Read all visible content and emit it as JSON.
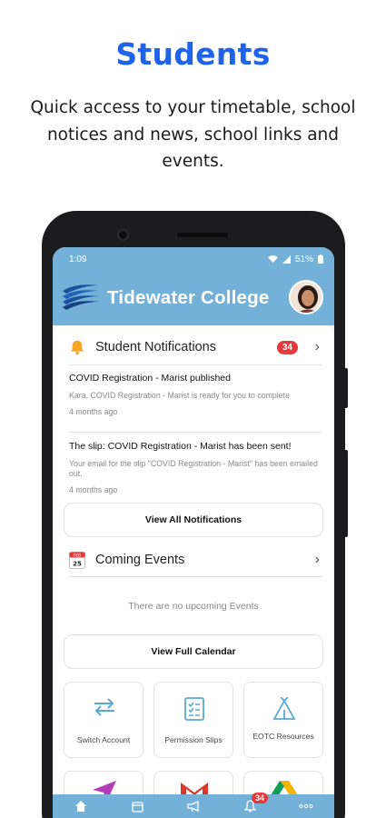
{
  "promo": {
    "title": "Students",
    "subtitle": "Quick access to your timetable, school notices and news, school links and events."
  },
  "status_bar": {
    "time": "1:09",
    "battery": "51%"
  },
  "app": {
    "title": "Tidewater College"
  },
  "notifications": {
    "title": "Student Notifications",
    "badge": "34",
    "items": [
      {
        "title": "COVID Registration - Marist published",
        "body": "Kara, COVID Registration - Marist is ready for you to complete",
        "time": "4 months ago"
      },
      {
        "title": "The slip: COVID Registration - Marist has been sent!",
        "body": "Your email for the slip \"COVID Registration - Marist\" has been emailed out.",
        "time": "4 months ago"
      }
    ],
    "view_all_label": "View All Notifications"
  },
  "events": {
    "title": "Coming Events",
    "calendar_month": "FEB",
    "calendar_day": "25",
    "empty_text": "There are no upcoming Events",
    "view_calendar_label": "View Full Calendar"
  },
  "tiles": [
    {
      "label": "Switch Account",
      "icon": "swap-arrows-icon"
    },
    {
      "label": "Permission Slips",
      "icon": "checklist-icon"
    },
    {
      "label": "EOTC Resources",
      "icon": "tent-icon"
    }
  ],
  "bottom_nav": {
    "notification_badge": "34"
  },
  "colors": {
    "brand_blue": "#1e63e9",
    "app_bar": "#73b1d8",
    "badge": "#e5393c"
  }
}
